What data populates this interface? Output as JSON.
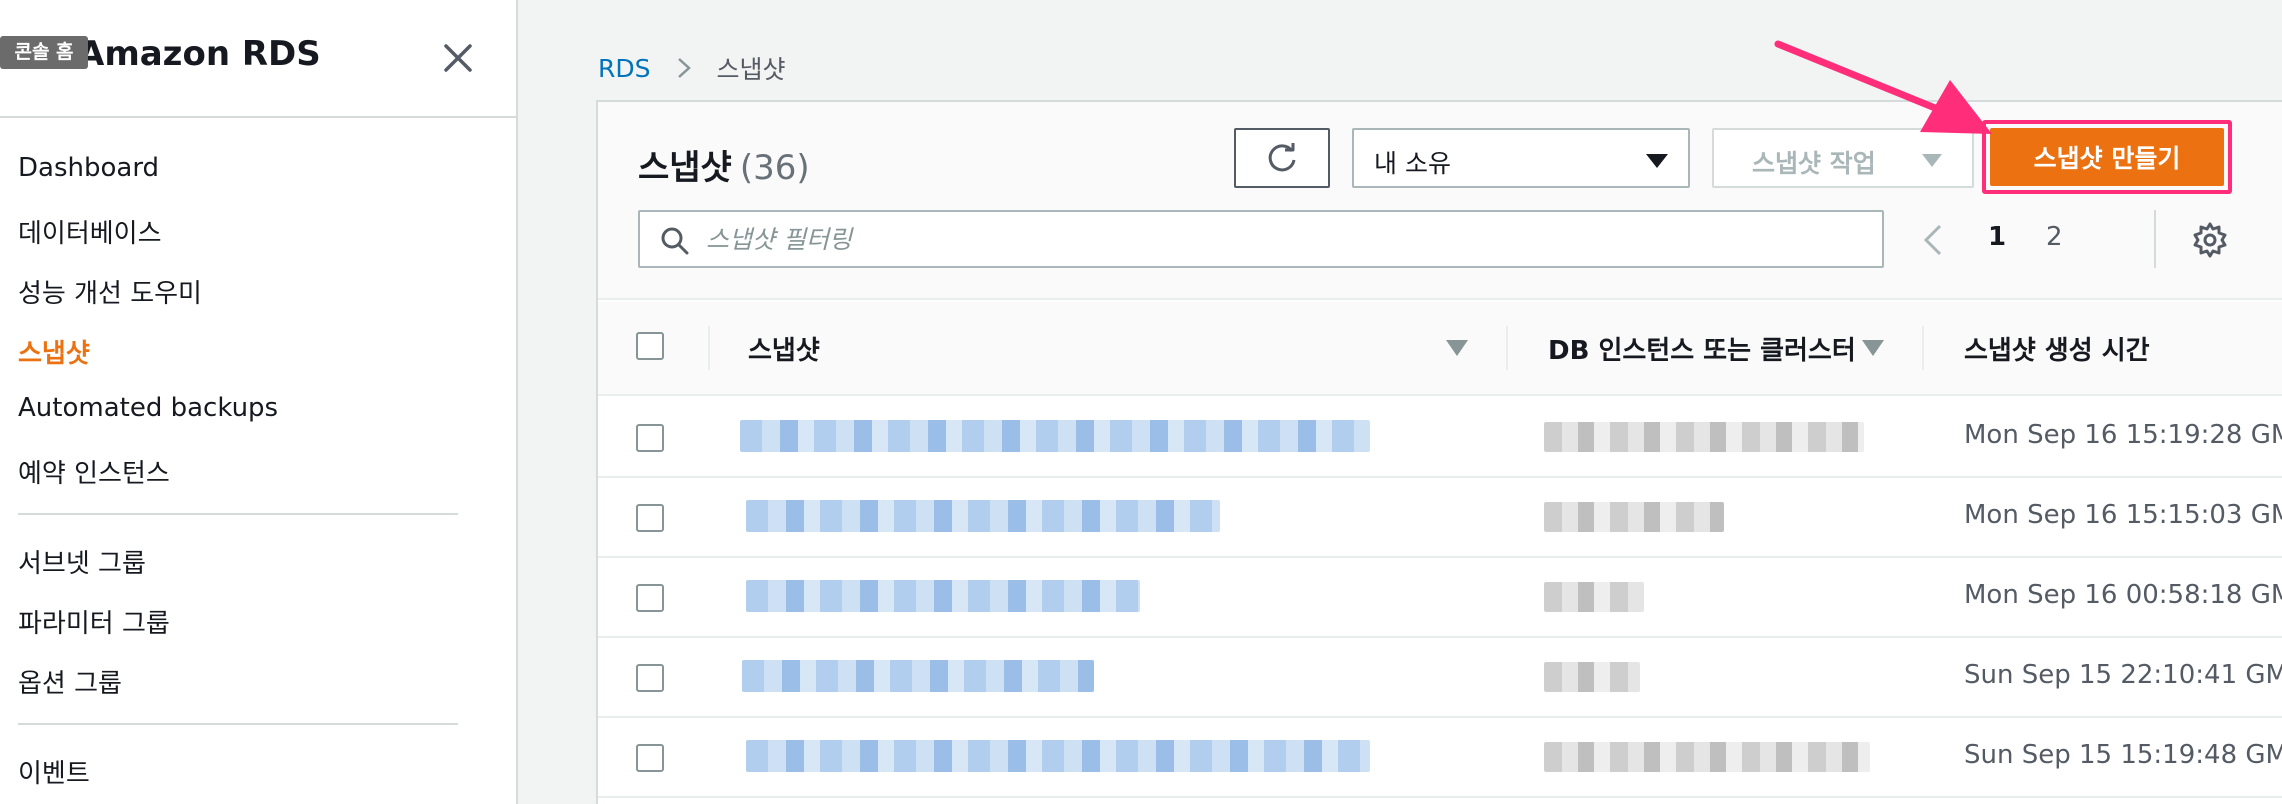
{
  "tooltip": "콘솔 홈",
  "sidebar": {
    "title": "Amazon RDS",
    "items": [
      {
        "label": "Dashboard"
      },
      {
        "label": "데이터베이스"
      },
      {
        "label": "성능 개선 도우미"
      },
      {
        "label": "스냅샷",
        "active": true
      },
      {
        "label": "Automated backups"
      },
      {
        "label": "예약 인스턴스"
      },
      {
        "label": "서브넷 그룹"
      },
      {
        "label": "파라미터 그룹"
      },
      {
        "label": "옵션 그룹"
      },
      {
        "label": "이벤트"
      }
    ]
  },
  "breadcrumb": {
    "root": "RDS",
    "current": "스냅샷"
  },
  "panel": {
    "title": "스냅샷",
    "count": "(36)",
    "owner_filter": "내 소유",
    "actions_label": "스냅샷 작업",
    "create_label": "스냅샷 만들기",
    "search_placeholder": "스냅샷 필터링",
    "pagination": {
      "current": "1",
      "next": "2"
    }
  },
  "table": {
    "columns": [
      "스냅샷",
      "DB 인스턴스 또는 클러스터",
      "스냅샷 생성 시간"
    ],
    "rows": [
      {
        "created": "Mon Sep 16 15:19:28 GM"
      },
      {
        "created": "Mon Sep 16 15:15:03 GM"
      },
      {
        "created": "Mon Sep 16 00:58:18 GM"
      },
      {
        "created": "Sun Sep 15 22:10:41 GM"
      },
      {
        "created": "Sun Sep 15 15:19:48 GM"
      }
    ]
  },
  "colors": {
    "accent": "#ec7211",
    "link": "#0073bb",
    "annotation": "#ff2d7a"
  },
  "icons": [
    "close-icon",
    "chevron-right-icon",
    "refresh-icon",
    "caret-down-icon",
    "search-icon",
    "chevron-left-icon",
    "gear-icon",
    "sort-down-icon",
    "annotation-arrow-icon"
  ]
}
